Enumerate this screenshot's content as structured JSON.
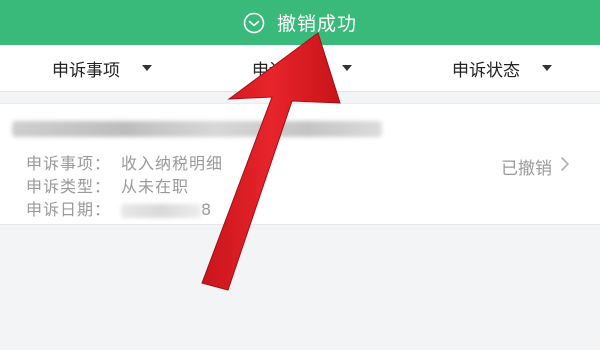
{
  "toast": {
    "message": "撤销成功",
    "icon": "check-circle-icon",
    "background": "#39b97a"
  },
  "filters": [
    {
      "label": "申诉事项"
    },
    {
      "label": "申诉类型"
    },
    {
      "label": "申诉状态"
    }
  ],
  "record": {
    "item_label": "申诉事项：",
    "item_value": "收入纳税明细",
    "type_label": "申诉类型：",
    "type_value": "从未在职",
    "date_label": "申诉日期：",
    "date_value_suffix": "8",
    "status": "已撤销"
  },
  "annotation": {
    "color": "#e21f26",
    "shape": "arrow"
  }
}
